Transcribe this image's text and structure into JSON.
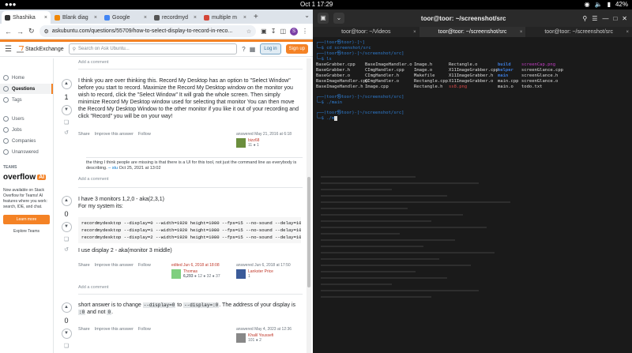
{
  "topbar": {
    "activities": "Activities",
    "clock": "Oct 1  17:29",
    "battery": "42%"
  },
  "browser": {
    "tabs": [
      {
        "title": "Shashika",
        "color": "#333333"
      },
      {
        "title": "Blank diag",
        "color": "#f08705"
      },
      {
        "title": "Google",
        "color": "#4285f4"
      },
      {
        "title": "recordmyd",
        "color": "#555555"
      },
      {
        "title": "multiple m",
        "color": "#d44638"
      }
    ],
    "url": "askubuntu.com/questions/55709/how-to-select-display-to-record-in-reco...",
    "header": {
      "brand": "StackExchange",
      "search_placeholder": "Search on Ask Ubuntu...",
      "login": "Log in",
      "signup": "Sign up"
    },
    "sidebar": {
      "items": [
        {
          "label": "Home",
          "active": false
        },
        {
          "label": "Questions",
          "active": true
        },
        {
          "label": "Tags",
          "active": false
        },
        {
          "label": "Users",
          "active": false
        },
        {
          "label": "Jobs",
          "active": false
        },
        {
          "label": "Companies",
          "active": false
        },
        {
          "label": "Unanswered",
          "active": false
        }
      ],
      "teams_heading": "TEAMS",
      "overflow_brand": "overflow",
      "overflow_ai": "AI",
      "promo": "Now available on Stack Overflow for Teams! AI features where you work: search, IDE, and chat.",
      "learn": "Learn more",
      "explore": "Explore Teams"
    },
    "top_add_comment": "Add a comment",
    "answers": [
      {
        "score": "1",
        "body": "I think you are over thinking this. Record My Desktop has an option to \"Select Window\" before you start to record. Maximize the Record My Desktop window on the monitor you wish to record, click the \"Select Window\" It will grab the whole screen. Then simply minimize Record My Desktop window used for selecting that monitor You can then move the Record My Desktop Window to the other monitor if you like it out of your recording and click \"Record\" you will be on your way!",
        "share": "Share",
        "improve": "Improve this answer",
        "follow": "Follow",
        "answered": "answered May 21, 2016 at 6:18",
        "user": "bizz68",
        "rep": "11",
        "badges": "● 1",
        "comment_text": "the thing I think people are missing is that there is a UI for this tool, not just the command line as everybody is describing.",
        "comment_user": "– stu",
        "comment_date": "Oct 25, 2021 at 13:02",
        "add_comment": "Add a comment"
      },
      {
        "score": "0",
        "line1": "I have 3 monitors 1,2,0 - aka(2,3,1)",
        "line2": "For my system its:",
        "code": "recordmydesktop --display=0 --width=1920 height=1080 --fps=15 --no-sound --delay=10\nrecordmydesktop --display=1 --width=1920 height=1080 --fps=15 --no-sound --delay=10\nrecordmydesktop --display=2 --width=1920 height=1080 --fps=15 --no-sound --delay=10",
        "line3": "I use display 2 - aka(monitor 3 middle)",
        "share": "Share",
        "improve": "Improve this answer",
        "follow": "Follow",
        "edited": "edited Jun 6, 2018 at 18:08",
        "editor": "Thomas",
        "editor_rep": "6,293",
        "editor_badges": "● 12  ● 32  ● 37",
        "answered": "answered Jun 6, 2018 at 17:50",
        "user": "Lankster Price",
        "rep": "1",
        "add_comment": "Add a comment"
      },
      {
        "score": "0",
        "t1": "short answer is to change ",
        "c1": "--display=0",
        "t2": " to ",
        "c2": "--display=:0",
        "t3": ". The address of your display is ",
        "c3": ":0",
        "t4": " and not ",
        "c4": "0",
        "t5": ".",
        "share": "Share",
        "improve": "Improve this answer",
        "follow": "Follow",
        "answered": "answered May 4, 2023 at 12:36",
        "user": "Khalil Youssefi",
        "rep": "101",
        "badges": "● 2"
      }
    ]
  },
  "terminal": {
    "title": "toor@toor: ~/screenshot/src",
    "tabs": [
      "toor@toor: ~/Videos",
      "toor@toor: ~/screenshot/src",
      "toor@toor: ~/screenshot/src"
    ],
    "lines": {
      "p1_user": "┌──(toor㉿toor)-[~]",
      "p1_cmd": "└─$ cd screenshot/src",
      "p2_user": "┌──(toor㉿toor)-[~/screenshot/src]",
      "p2_cmd": "└─$ ls",
      "p3_user": "┌──(toor㉿toor)-[~/screenshot/src]",
      "p3_cmd": "└─$ ./main",
      "p4_user": "┌──(toor㉿toor)-[~/screenshot/src]",
      "p4_cmd": "└─$ ./m"
    },
    "ls_rows": [
      [
        "BaseGrabber.cpp",
        "BaseImageHandler.o",
        "Image.h",
        "Rectangle.o",
        "build",
        "screenCap.png"
      ],
      [
        "BaseGrabber.h",
        "CImgHandler.cpp",
        "Image.o",
        "X11ImageGrabber.cpp",
        "helper",
        "screenGlance.cpp"
      ],
      [
        "BaseGrabber.o",
        "CImgHandler.h",
        "Makefile",
        "X11ImageGrabber.h",
        "main",
        "screenGlance.h"
      ],
      [
        "BaseImageHandler.cpp",
        "CImgHandler.o",
        "Rectangle.cpp",
        "X11ImageGrabber.o",
        "main.cpp",
        "screenGlance.o"
      ],
      [
        "BaseImageHandler.h",
        "Image.cpp",
        "Rectangle.h",
        "ss8.png",
        "main.o",
        "todo.txt"
      ]
    ]
  }
}
